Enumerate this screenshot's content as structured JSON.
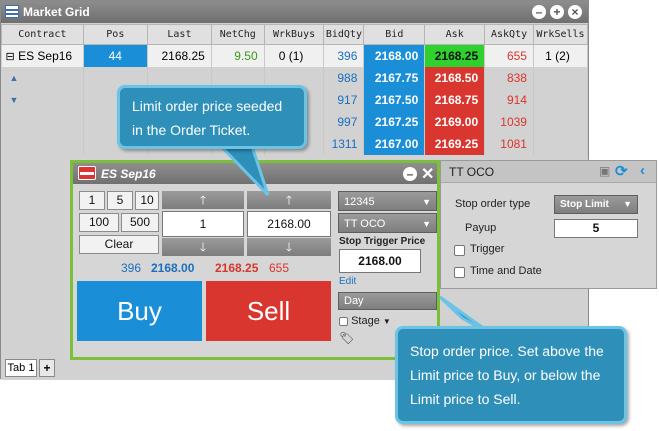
{
  "market_grid": {
    "title": "Market Grid",
    "columns": [
      "Contract",
      "Pos",
      "Last",
      "NetChg",
      "WrkBuys",
      "BidQty",
      "Bid",
      "Ask",
      "AskQty",
      "WrkSells"
    ],
    "contract": {
      "expander": "⊟",
      "name": "ES Sep16",
      "pos": "44",
      "last": "2168.25",
      "netchg": "9.50",
      "wrkbuys": "0 (1)",
      "wrksells": "1 (2)"
    },
    "depth": [
      {
        "bidqty": "396",
        "bid": "2168.00",
        "ask": "2168.25",
        "askqty": "655"
      },
      {
        "bidqty": "988",
        "bid": "2167.75",
        "ask": "2168.50",
        "askqty": "838"
      },
      {
        "bidqty": "917",
        "bid": "2167.50",
        "ask": "2168.75",
        "askqty": "914"
      },
      {
        "bidqty": "997",
        "bid": "2167.25",
        "ask": "2169.00",
        "askqty": "1039"
      },
      {
        "bidqty": "1311",
        "bid": "2167.00",
        "ask": "2169.25",
        "askqty": "1081"
      }
    ],
    "tab_label": "Tab 1",
    "add_tab": "+"
  },
  "order_ticket": {
    "title": "ES Sep16",
    "qty_buttons": [
      "1",
      "5",
      "10",
      "100",
      "500"
    ],
    "clear_label": "Clear",
    "quantity": "1",
    "price": "2168.00",
    "account": "12345",
    "order_type": "TT OCO",
    "stop_trigger_label": "Stop Trigger Price",
    "stop_trigger_price": "2168.00",
    "edit_label": "Edit",
    "tif": "Day",
    "stage_label": "Stage",
    "market": {
      "bidqty": "396",
      "bid": "2168.00",
      "ask": "2168.25",
      "askqty": "655"
    },
    "buy_label": "Buy",
    "sell_label": "Sell"
  },
  "tt_oco": {
    "title": "TT OCO",
    "stop_order_type_label": "Stop order type",
    "stop_order_type": "Stop Limit",
    "payup_label": "Payup",
    "payup_value": "5",
    "trigger_label": "Trigger",
    "time_and_date_label": "Time and Date"
  },
  "callouts": {
    "limit": "Limit order price seeded in the Order Ticket.",
    "stop": "Stop order price. Set above the Limit price to Buy, or below the Limit price to Sell."
  },
  "colors": {
    "bid": "#1a8fd8",
    "ask": "#d9362f",
    "best_ask": "#2fd12f",
    "accent": "#7bbf3a",
    "callout": "#2e8fb8"
  }
}
